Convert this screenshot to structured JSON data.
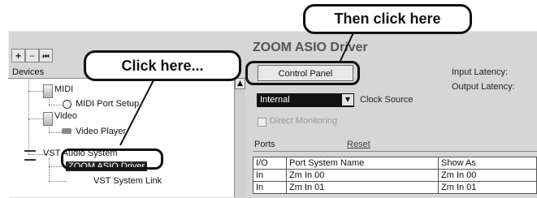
{
  "toolbar": {
    "add": "+",
    "remove": "−",
    "reset": "⏮"
  },
  "devices": {
    "label": "Devices",
    "tree": [
      {
        "label": "MIDI"
      },
      {
        "label": "MIDI Port Setup"
      },
      {
        "label": "Video"
      },
      {
        "label": "Video Player"
      },
      {
        "label": "VST Audio System"
      },
      {
        "label": "ZOOM ASIO Driver"
      },
      {
        "label": "VST System Link"
      }
    ]
  },
  "panel": {
    "title": "ZOOM ASIO Driver",
    "control_panel": "Control Panel",
    "input_latency": "Input Latency:",
    "output_latency": "Output Latency:",
    "clock_select": "Internal",
    "clock_source": "Clock Source",
    "direct_monitoring": "Direct Monitoring",
    "ports": "Ports",
    "reset": "Reset"
  },
  "ports_table": {
    "headers": [
      "I/O",
      "Port System Name",
      "Show As"
    ],
    "rows": [
      [
        "In",
        "Zm In 00",
        "Zm In 00"
      ],
      [
        "In",
        "Zm In 01",
        "Zm In 01"
      ]
    ]
  },
  "callouts": {
    "click_here": "Click here...",
    "then_click": "Then click here"
  }
}
